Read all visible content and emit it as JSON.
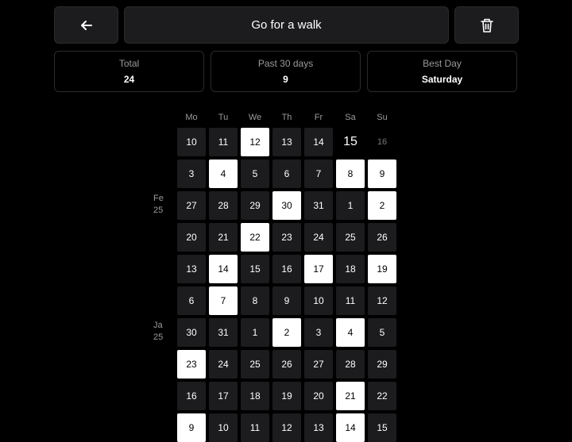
{
  "header": {
    "back_icon": "arrow-left-icon",
    "title": "Go for a walk",
    "delete_icon": "trash-icon"
  },
  "stats": {
    "total_label": "Total",
    "total_value": "24",
    "past_label": "Past 30 days",
    "past_value": "9",
    "best_label": "Best Day",
    "best_value": "Saturday"
  },
  "weekdays": [
    "Mo",
    "Tu",
    "We",
    "Th",
    "Fr",
    "Sa",
    "Su"
  ],
  "month_labels": [
    {
      "label_line1": "Fe",
      "label_line2": "25",
      "row": 2
    },
    {
      "label_line1": "Ja",
      "label_line2": "25",
      "row": 6
    }
  ],
  "weeks": [
    [
      {
        "d": "10",
        "s": "off"
      },
      {
        "d": "11",
        "s": "off"
      },
      {
        "d": "12",
        "s": "on"
      },
      {
        "d": "13",
        "s": "off"
      },
      {
        "d": "14",
        "s": "off"
      },
      {
        "d": "15",
        "s": "today"
      },
      {
        "d": "16",
        "s": "future"
      }
    ],
    [
      {
        "d": "3",
        "s": "off"
      },
      {
        "d": "4",
        "s": "on"
      },
      {
        "d": "5",
        "s": "off"
      },
      {
        "d": "6",
        "s": "off"
      },
      {
        "d": "7",
        "s": "off"
      },
      {
        "d": "8",
        "s": "on"
      },
      {
        "d": "9",
        "s": "on"
      }
    ],
    [
      {
        "d": "27",
        "s": "off"
      },
      {
        "d": "28",
        "s": "off"
      },
      {
        "d": "29",
        "s": "off"
      },
      {
        "d": "30",
        "s": "on"
      },
      {
        "d": "31",
        "s": "off"
      },
      {
        "d": "1",
        "s": "off"
      },
      {
        "d": "2",
        "s": "on"
      }
    ],
    [
      {
        "d": "20",
        "s": "off"
      },
      {
        "d": "21",
        "s": "off"
      },
      {
        "d": "22",
        "s": "on"
      },
      {
        "d": "23",
        "s": "off"
      },
      {
        "d": "24",
        "s": "off"
      },
      {
        "d": "25",
        "s": "off"
      },
      {
        "d": "26",
        "s": "off"
      }
    ],
    [
      {
        "d": "13",
        "s": "off"
      },
      {
        "d": "14",
        "s": "on"
      },
      {
        "d": "15",
        "s": "off"
      },
      {
        "d": "16",
        "s": "off"
      },
      {
        "d": "17",
        "s": "on"
      },
      {
        "d": "18",
        "s": "off"
      },
      {
        "d": "19",
        "s": "on"
      }
    ],
    [
      {
        "d": "6",
        "s": "off"
      },
      {
        "d": "7",
        "s": "on"
      },
      {
        "d": "8",
        "s": "off"
      },
      {
        "d": "9",
        "s": "off"
      },
      {
        "d": "10",
        "s": "off"
      },
      {
        "d": "11",
        "s": "off"
      },
      {
        "d": "12",
        "s": "off"
      }
    ],
    [
      {
        "d": "30",
        "s": "off"
      },
      {
        "d": "31",
        "s": "off"
      },
      {
        "d": "1",
        "s": "off"
      },
      {
        "d": "2",
        "s": "on"
      },
      {
        "d": "3",
        "s": "off"
      },
      {
        "d": "4",
        "s": "on"
      },
      {
        "d": "5",
        "s": "off"
      }
    ],
    [
      {
        "d": "23",
        "s": "on"
      },
      {
        "d": "24",
        "s": "off"
      },
      {
        "d": "25",
        "s": "off"
      },
      {
        "d": "26",
        "s": "off"
      },
      {
        "d": "27",
        "s": "off"
      },
      {
        "d": "28",
        "s": "off"
      },
      {
        "d": "29",
        "s": "off"
      }
    ],
    [
      {
        "d": "16",
        "s": "off"
      },
      {
        "d": "17",
        "s": "off"
      },
      {
        "d": "18",
        "s": "off"
      },
      {
        "d": "19",
        "s": "off"
      },
      {
        "d": "20",
        "s": "off"
      },
      {
        "d": "21",
        "s": "on"
      },
      {
        "d": "22",
        "s": "off"
      }
    ],
    [
      {
        "d": "9",
        "s": "on"
      },
      {
        "d": "10",
        "s": "off"
      },
      {
        "d": "11",
        "s": "off"
      },
      {
        "d": "12",
        "s": "off"
      },
      {
        "d": "13",
        "s": "off"
      },
      {
        "d": "14",
        "s": "on"
      },
      {
        "d": "15",
        "s": "off"
      }
    ]
  ]
}
